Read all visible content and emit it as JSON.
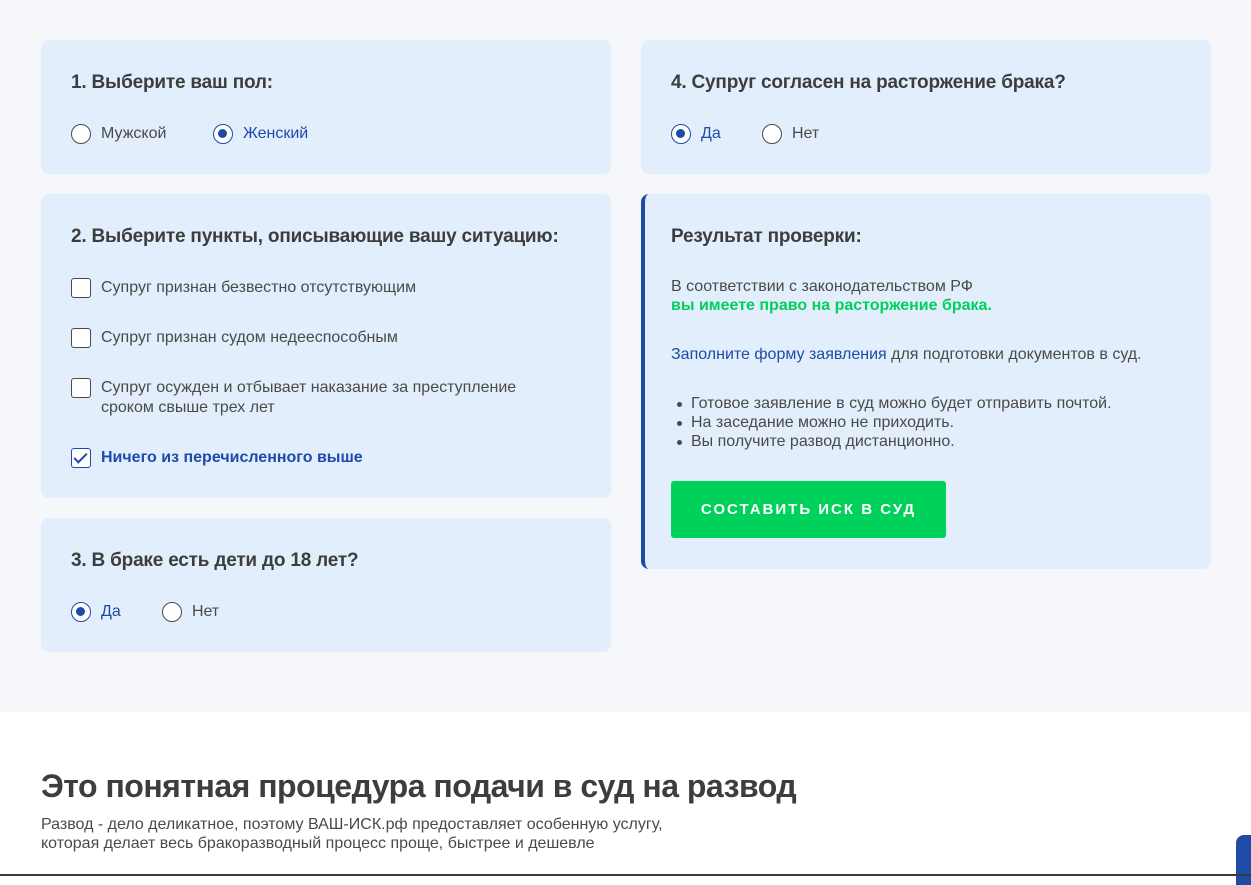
{
  "gender": {
    "title": "1. Выберите ваш пол:",
    "options": [
      {
        "label": "Мужской",
        "selected": false
      },
      {
        "label": "Женский",
        "selected": true
      }
    ]
  },
  "situation": {
    "title": "2. Выберите пункты, описывающие вашу ситуацию:",
    "items": [
      {
        "label": "Супруг признан безвестно отсутствующим",
        "checked": false
      },
      {
        "label": "Супруг признан судом недееспособным",
        "checked": false
      },
      {
        "label_line1": "Супруг осужден и отбывает наказание за преступление",
        "label_line2": "сроком свыше трех лет",
        "checked": false
      },
      {
        "label": "Ничего из перечисленного выше",
        "checked": true
      }
    ]
  },
  "children": {
    "title": "3. В браке есть дети до 18 лет?",
    "options": [
      {
        "label": "Да",
        "selected": true
      },
      {
        "label": "Нет",
        "selected": false
      }
    ]
  },
  "consent": {
    "title": "4. Супруг согласен на расторжение брака?",
    "options": [
      {
        "label": "Да",
        "selected": true
      },
      {
        "label": "Нет",
        "selected": false
      }
    ]
  },
  "result": {
    "title": "Результат проверки:",
    "line1": "В соответствии с законодательством РФ",
    "line2": "вы имеете право на расторжение брака.",
    "link_text": "Заполните форму заявления",
    "link_rest": " для подготовки документов в суд.",
    "bullets": [
      "Готовое заявление в суд можно будет отправить почтой.",
      "На заседание можно не приходить.",
      "Вы получите развод дистанционно."
    ],
    "button_label": "СОСТАВИТЬ ИСК В СУД"
  },
  "promo": {
    "title": "Это понятная процедура подачи в суд на развод",
    "subtitle_line1": "Развод - дело деликатное, поэтому ВАШ-ИСК.рф предоставляет особенную услугу,",
    "subtitle_line2": "которая делает весь бракоразводный процесс проще, быстрее и дешевле"
  },
  "colors": {
    "accent_blue": "#1e4aa8",
    "accent_green": "#00d15a",
    "card_bg": "#e2eefc",
    "page_bg": "#f5f7fa"
  }
}
